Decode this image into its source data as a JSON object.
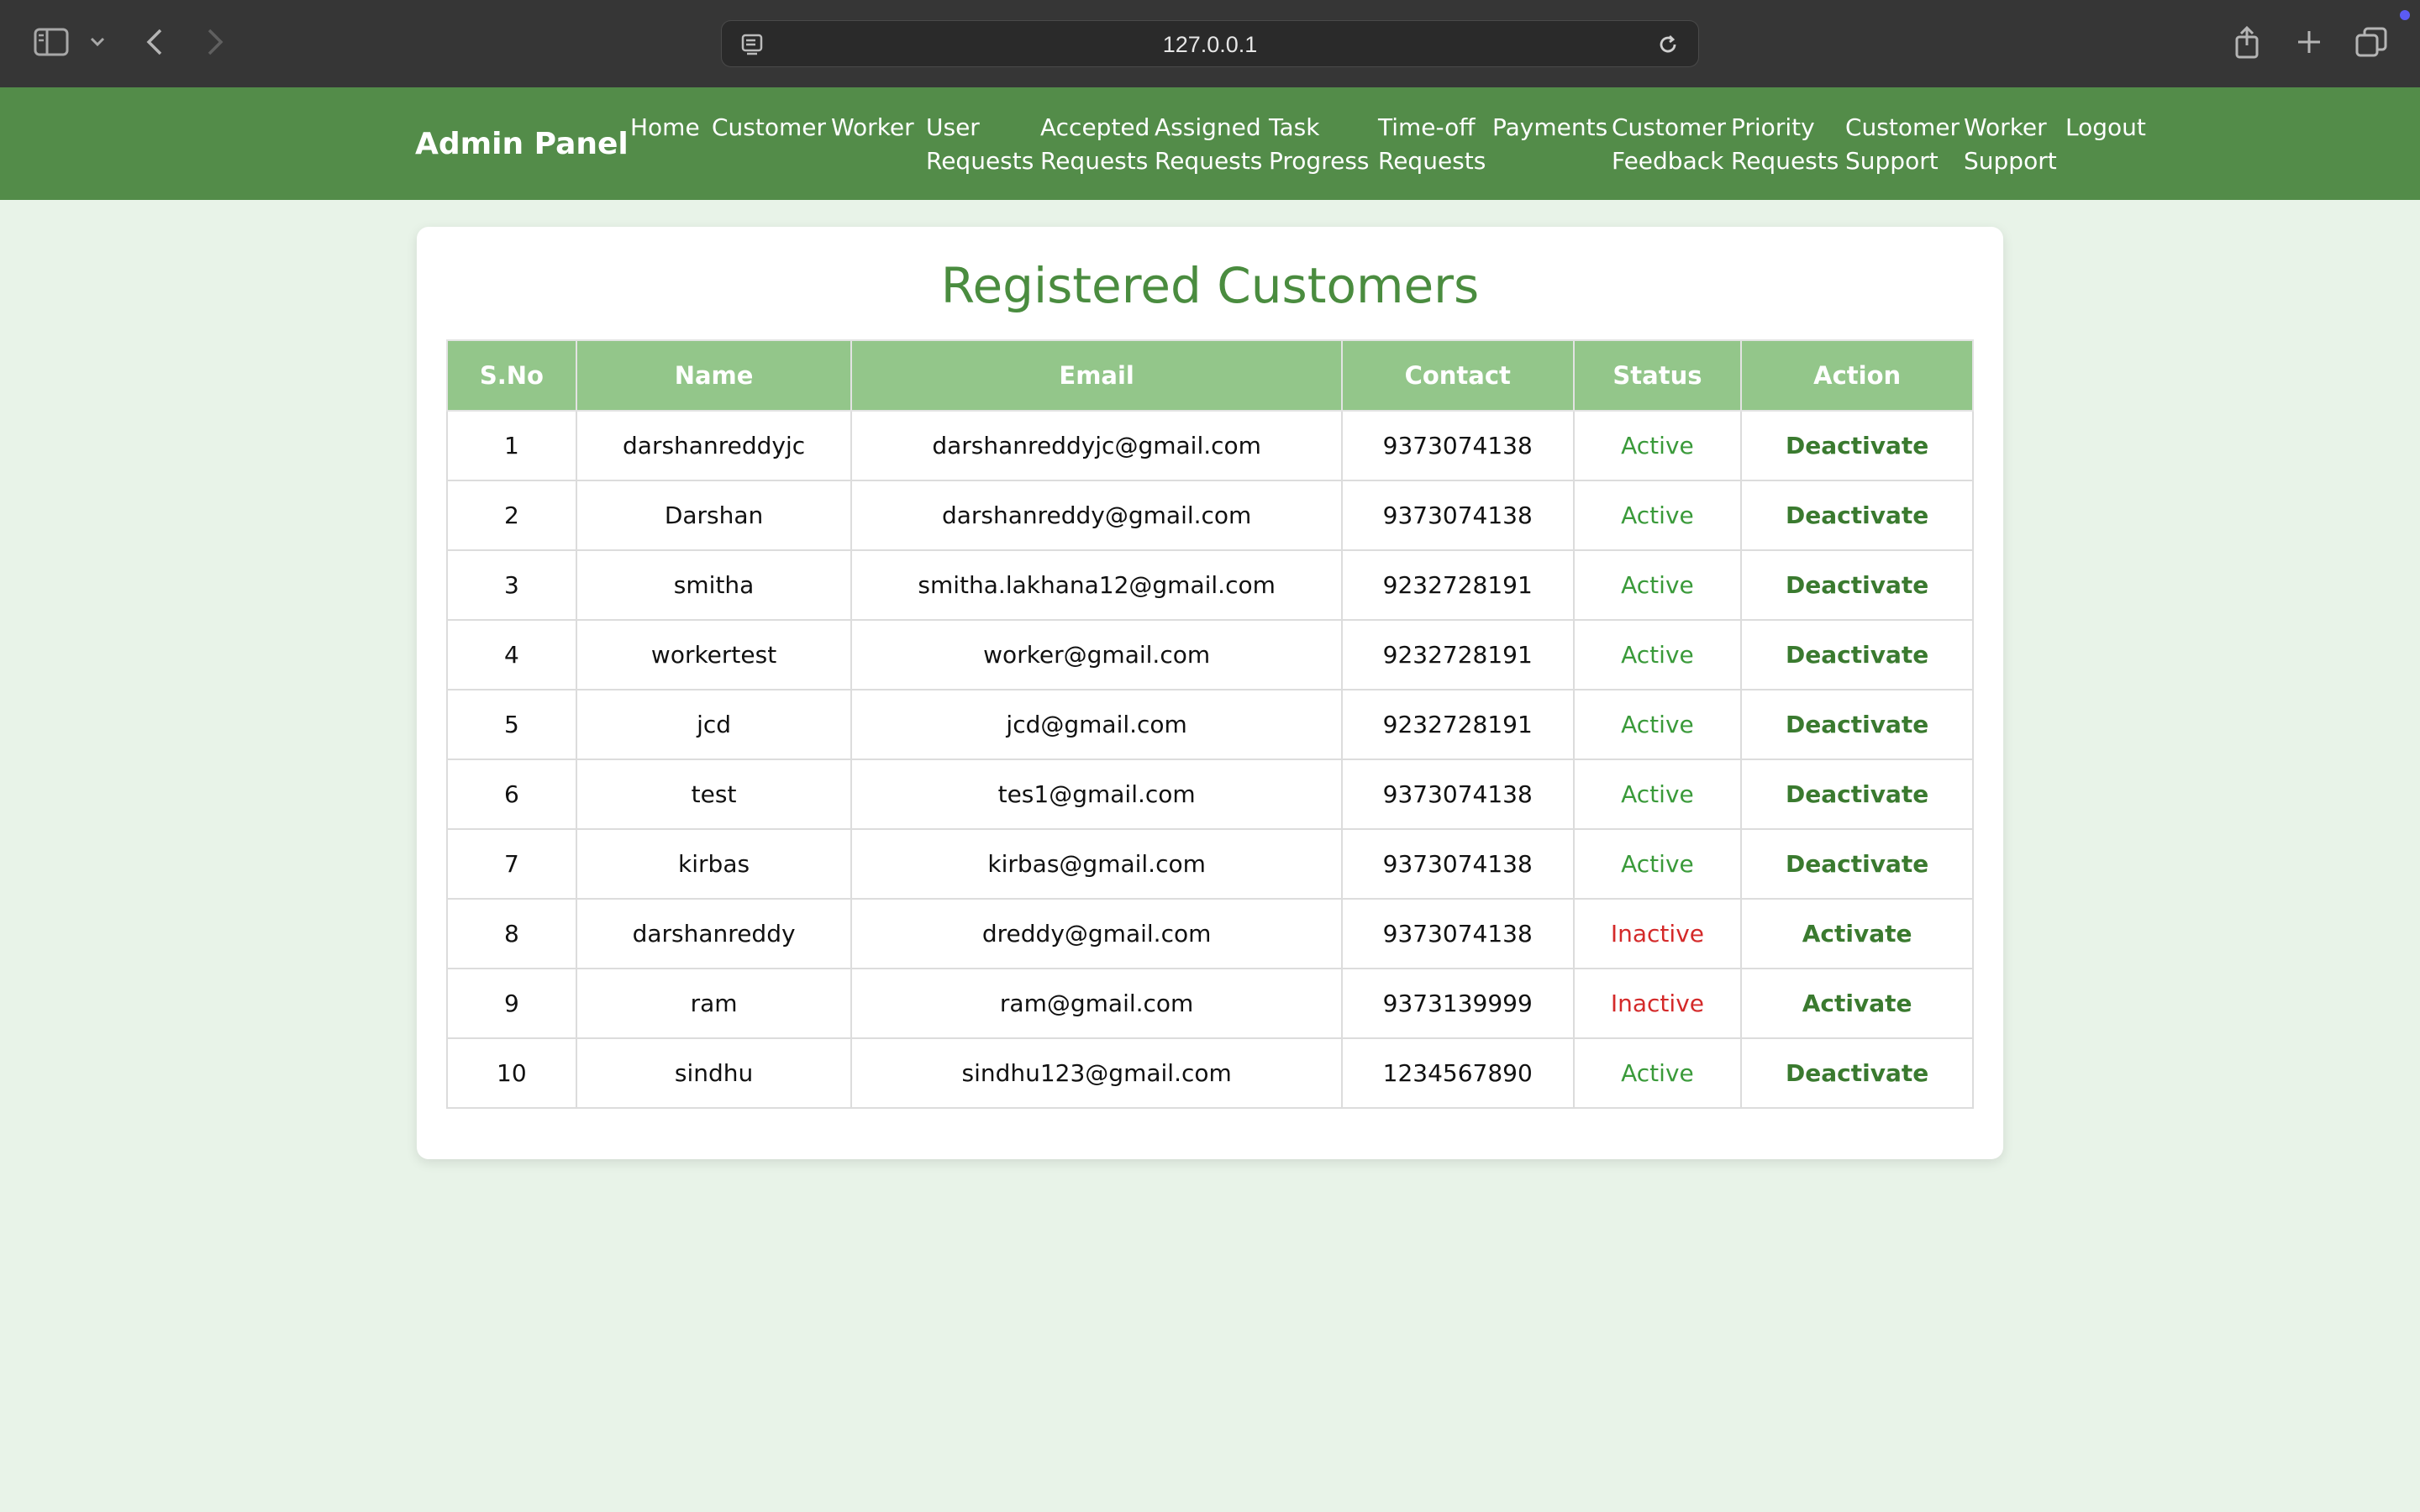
{
  "browser": {
    "url": "127.0.0.1"
  },
  "nav": {
    "brand": "Admin Panel",
    "items": [
      {
        "label": "Home"
      },
      {
        "label": "Customer"
      },
      {
        "label": "Worker"
      },
      {
        "label": "User\nRequests"
      },
      {
        "label": "Accepted\nRequests"
      },
      {
        "label": "Assigned\nRequests"
      },
      {
        "label": "Task\nProgress"
      },
      {
        "label": "Time-off\nRequests"
      },
      {
        "label": "Payments"
      },
      {
        "label": "Customer\nFeedback"
      },
      {
        "label": "Priority\nRequests"
      },
      {
        "label": "Customer\nSupport"
      },
      {
        "label": "Worker\nSupport"
      },
      {
        "label": "Logout"
      }
    ]
  },
  "main": {
    "title": "Registered Customers",
    "columns": [
      "S.No",
      "Name",
      "Email",
      "Contact",
      "Status",
      "Action"
    ],
    "rows": [
      {
        "sno": "1",
        "name": "darshanreddyjc",
        "email": "darshanreddyjc@gmail.com",
        "contact": "9373074138",
        "status": "Active",
        "action": "Deactivate"
      },
      {
        "sno": "2",
        "name": "Darshan",
        "email": "darshanreddy@gmail.com",
        "contact": "9373074138",
        "status": "Active",
        "action": "Deactivate"
      },
      {
        "sno": "3",
        "name": "smitha",
        "email": "smitha.lakhana12@gmail.com",
        "contact": "9232728191",
        "status": "Active",
        "action": "Deactivate"
      },
      {
        "sno": "4",
        "name": "workertest",
        "email": "worker@gmail.com",
        "contact": "9232728191",
        "status": "Active",
        "action": "Deactivate"
      },
      {
        "sno": "5",
        "name": "jcd",
        "email": "jcd@gmail.com",
        "contact": "9232728191",
        "status": "Active",
        "action": "Deactivate"
      },
      {
        "sno": "6",
        "name": "test",
        "email": "tes1@gmail.com",
        "contact": "9373074138",
        "status": "Active",
        "action": "Deactivate"
      },
      {
        "sno": "7",
        "name": "kirbas",
        "email": "kirbas@gmail.com",
        "contact": "9373074138",
        "status": "Active",
        "action": "Deactivate"
      },
      {
        "sno": "8",
        "name": "darshanreddy",
        "email": "dreddy@gmail.com",
        "contact": "9373074138",
        "status": "Inactive",
        "action": "Activate"
      },
      {
        "sno": "9",
        "name": "ram",
        "email": "ram@gmail.com",
        "contact": "9373139999",
        "status": "Inactive",
        "action": "Activate"
      },
      {
        "sno": "10",
        "name": "sindhu",
        "email": "sindhu123@gmail.com",
        "contact": "1234567890",
        "status": "Active",
        "action": "Deactivate"
      }
    ]
  },
  "colors": {
    "navbar": "#538c49",
    "header_row": "#93c68a",
    "active": "#3a9a3a",
    "inactive": "#d42a2a",
    "action": "#3a7a2f",
    "page_bg": "#e8f3e8"
  },
  "icons": {
    "sidebar": "sidebar-icon",
    "chevron": "chevron-down-icon",
    "back": "back-arrow-icon",
    "forward": "forward-arrow-icon",
    "site": "site-info-icon",
    "reload": "reload-icon",
    "share": "share-icon",
    "new_tab": "plus-icon",
    "tabs": "tabs-overview-icon"
  }
}
